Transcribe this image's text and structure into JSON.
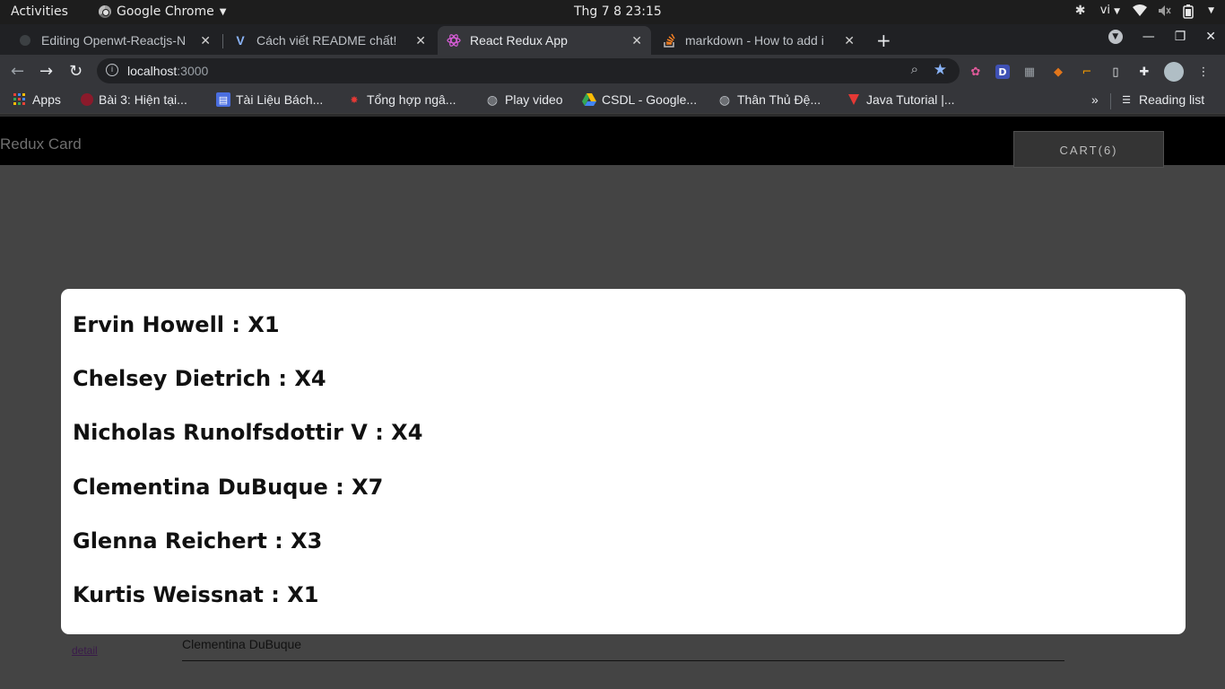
{
  "system": {
    "activities": "Activities",
    "app_name": "Google Chrome",
    "clock": "Thg 7 8  23:15",
    "language": "vi"
  },
  "tabs": [
    {
      "title": "Editing Openwt-Reactjs-N",
      "active": false
    },
    {
      "title": "Cách viết README chất!",
      "active": false
    },
    {
      "title": "React Redux App",
      "active": true
    },
    {
      "title": "markdown - How to add i",
      "active": false
    }
  ],
  "address_bar": {
    "host": "localhost",
    "port": ":3000"
  },
  "bookmarks": [
    {
      "label": "Apps",
      "icon": "apps-grid-icon"
    },
    {
      "label": "Bài 3: Hiện tại...",
      "icon": "site-icon"
    },
    {
      "label": "Tài Liệu Bách...",
      "icon": "docs-icon"
    },
    {
      "label": "Tổng hợp ngâ...",
      "icon": "site-icon"
    },
    {
      "label": "Play video",
      "icon": "globe-icon"
    },
    {
      "label": "CSDL - Google...",
      "icon": "drive-icon"
    },
    {
      "label": "Thân Thủ Đệ...",
      "icon": "globe-icon"
    },
    {
      "label": "Java Tutorial |...",
      "icon": "site-icon"
    }
  ],
  "bookmarks_overflow": "»",
  "reading_list": "Reading list",
  "app": {
    "brand": "Redux Card",
    "cart_label": "CART(6)"
  },
  "background_card": {
    "detail_link": "detail",
    "name": "Clementina DuBuque"
  },
  "modal": {
    "items": [
      "Ervin Howell : X1",
      "Chelsey Dietrich : X4",
      "Nicholas Runolfsdottir V : X4",
      "Clementina DuBuque : X7",
      "Glenna Reichert : X3",
      "Kurtis Weissnat : X1"
    ]
  }
}
